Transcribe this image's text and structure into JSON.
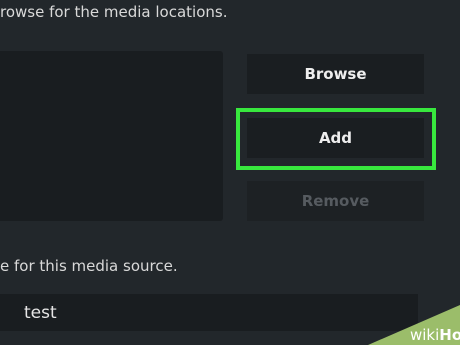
{
  "dialog": {
    "browse_instruction": "rowse for the media locations.",
    "buttons": {
      "browse": "Browse",
      "add": "Add",
      "remove": "Remove"
    },
    "name_instruction": "e for this media source.",
    "name_value": "test"
  },
  "colors": {
    "background": "#22272b",
    "panel": "#191d20",
    "highlight": "#38e83e",
    "disabled_text": "#565b60"
  },
  "watermark": {
    "text": "wikiHow"
  }
}
